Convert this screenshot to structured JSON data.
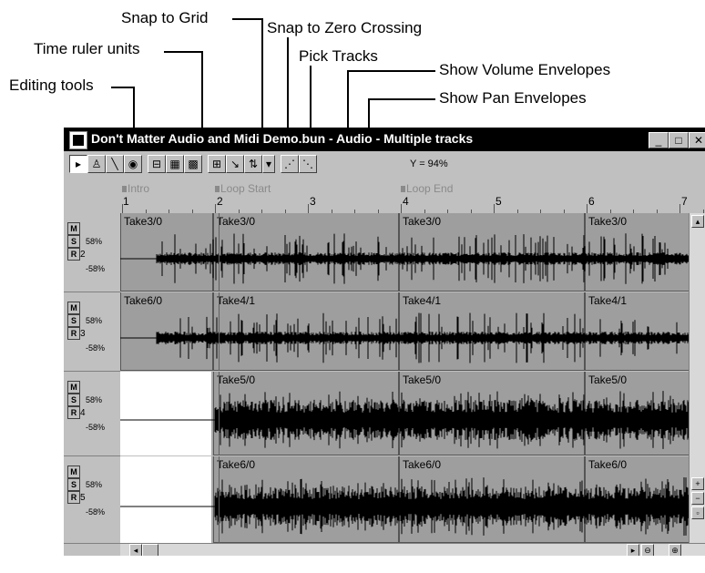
{
  "callouts": {
    "snap_to_grid": "Snap to Grid",
    "snap_zero": "Snap to Zero Crossing",
    "time_ruler": "Time ruler units",
    "pick_tracks": "Pick Tracks",
    "editing_tools": "Editing tools",
    "show_volume": "Show Volume Envelopes",
    "show_pan": "Show Pan Envelopes"
  },
  "window": {
    "title": "Don't Matter Audio and Midi Demo.bun - Audio - Multiple tracks",
    "minimize": "_",
    "maximize": "□",
    "close": "✕"
  },
  "toolbar": {
    "zoom_readout": "Y = 94%",
    "icons": [
      "pointer-tool-icon",
      "draw-tool-icon",
      "line-tool-icon",
      "scrub-tool-icon",
      "time-ruler-icon",
      "ruler-format-icon",
      "ruler-format-2-icon",
      "snap-grid-icon",
      "snap-zero-icon",
      "pick-tracks-icon",
      "dropdown-icon",
      "volume-envelope-icon",
      "pan-envelope-icon"
    ]
  },
  "ruler": {
    "markers": [
      "Intro",
      "Loop Start",
      "Loop End"
    ],
    "measures": [
      "1",
      "2",
      "3",
      "4",
      "5",
      "6",
      "7"
    ]
  },
  "tracks": [
    {
      "number": "2",
      "vol_top": "58%",
      "vol_bottom": "-58%",
      "clips": [
        "Take3/0",
        "Take3/0",
        "Take3/0",
        "Take3/0"
      ],
      "intro_clip": true
    },
    {
      "number": "3",
      "vol_top": "58%",
      "vol_bottom": "-58%",
      "clips": [
        "Take6/0",
        "Take4/1",
        "Take4/1",
        "Take4/1"
      ],
      "intro_clip": true
    },
    {
      "number": "4",
      "vol_top": "58%",
      "vol_bottom": "-58%",
      "clips": [
        "Take5/0",
        "Take5/0",
        "Take5/0"
      ],
      "intro_clip": false
    },
    {
      "number": "5",
      "vol_top": "58%",
      "vol_bottom": "-58%",
      "clips": [
        "Take6/0",
        "Take6/0",
        "Take6/0"
      ],
      "intro_clip": false
    }
  ],
  "track_buttons": {
    "mute": "M",
    "solo": "S",
    "record": "R"
  },
  "colors": {
    "title_bg": "#000000",
    "lane_bg": "#a8a8a8",
    "clip_bg": "#9e9e9e",
    "wave": "#000000"
  }
}
